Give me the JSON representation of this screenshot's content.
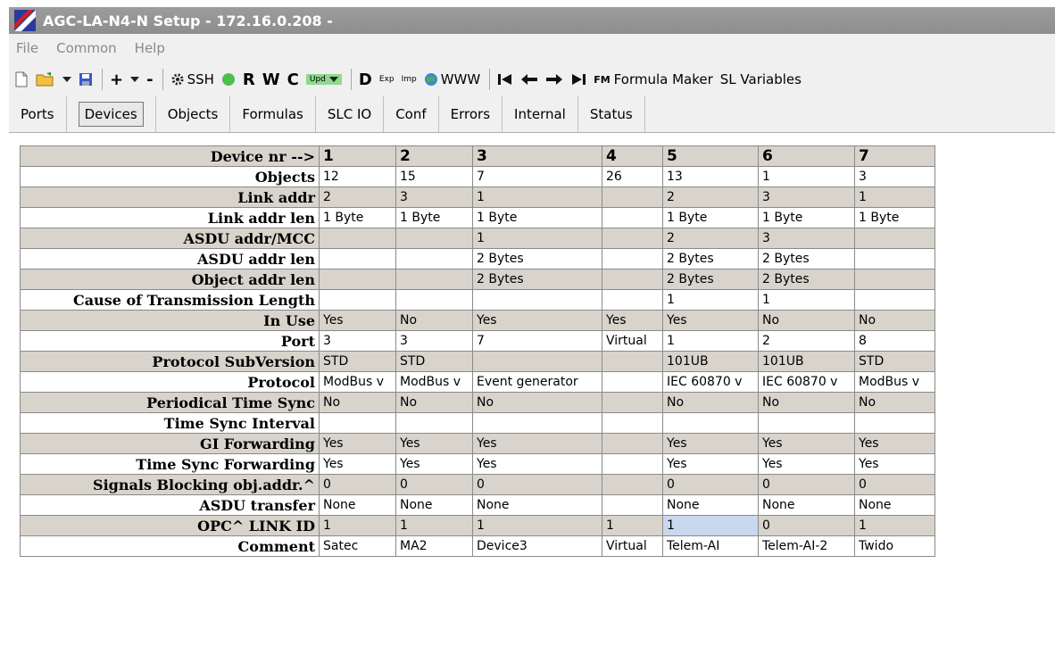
{
  "window": {
    "title": "AGC-LA-N4-N Setup - 172.16.0.208 -"
  },
  "menu": [
    "File",
    "Common",
    "Help"
  ],
  "toolbar": {
    "ssh": "SSH",
    "r": "R",
    "w": "W",
    "c": "C",
    "upd": "Upd",
    "d": "D",
    "exp": "Exp",
    "imp": "Imp",
    "www": "WWW",
    "fm": "FM",
    "formula_maker": "Formula Maker",
    "sl_variables": "SL Variables"
  },
  "tabs": [
    "Ports",
    "Devices",
    "Objects",
    "Formulas",
    "SLC IO",
    "Conf",
    "Errors",
    "Internal",
    "Status"
  ],
  "active_tab": "Devices",
  "table": {
    "columns": [
      "1",
      "2",
      "3",
      "4",
      "5",
      "6",
      "7"
    ],
    "header_label": "Device nr -->",
    "rows": [
      {
        "label": "Objects",
        "cells": [
          "12",
          "15",
          "7",
          "26",
          "13",
          "1",
          "3"
        ]
      },
      {
        "label": "Link addr",
        "cells": [
          "2",
          "3",
          "1",
          "",
          "2",
          "3",
          "1"
        ]
      },
      {
        "label": "Link addr len",
        "cells": [
          "1 Byte",
          "1 Byte",
          "1 Byte",
          "",
          "1 Byte",
          "1 Byte",
          "1 Byte"
        ]
      },
      {
        "label": "ASDU addr/MCC",
        "cells": [
          "",
          "",
          "1",
          "",
          "2",
          "3",
          ""
        ]
      },
      {
        "label": "ASDU addr len",
        "cells": [
          "",
          "",
          "2 Bytes",
          "",
          "2 Bytes",
          "2 Bytes",
          ""
        ]
      },
      {
        "label": "Object addr len",
        "cells": [
          "",
          "",
          "2 Bytes",
          "",
          "2 Bytes",
          "2 Bytes",
          ""
        ]
      },
      {
        "label": "Cause of Transmission Length",
        "cells": [
          "",
          "",
          "",
          "",
          "1",
          "1",
          ""
        ]
      },
      {
        "label": "In Use",
        "cells": [
          "Yes",
          "No",
          "Yes",
          "Yes",
          "Yes",
          "No",
          "No"
        ]
      },
      {
        "label": "Port",
        "cells": [
          "3",
          "3",
          "7",
          "Virtual",
          "1",
          "2",
          "8"
        ]
      },
      {
        "label": "Protocol SubVersion",
        "cells": [
          "STD",
          "STD",
          "",
          "",
          "101UB",
          "101UB",
          "STD"
        ]
      },
      {
        "label": "Protocol",
        "cells": [
          "ModBus v",
          "ModBus v",
          "Event generator",
          "",
          "IEC 60870 v",
          "IEC 60870 v",
          "ModBus v"
        ]
      },
      {
        "label": "Periodical Time Sync",
        "cells": [
          "No",
          "No",
          "No",
          "",
          "No",
          "No",
          "No"
        ]
      },
      {
        "label": "Time Sync Interval",
        "cells": [
          "",
          "",
          "",
          "",
          "",
          "",
          ""
        ]
      },
      {
        "label": "GI Forwarding",
        "cells": [
          "Yes",
          "Yes",
          "Yes",
          "",
          "Yes",
          "Yes",
          "Yes"
        ]
      },
      {
        "label": "Time Sync Forwarding",
        "cells": [
          "Yes",
          "Yes",
          "Yes",
          "",
          "Yes",
          "Yes",
          "Yes"
        ]
      },
      {
        "label": "Signals Blocking obj.addr.^",
        "cells": [
          "0",
          "0",
          "0",
          "",
          "0",
          "0",
          "0"
        ]
      },
      {
        "label": "ASDU transfer",
        "cells": [
          "None",
          "None",
          "None",
          "",
          "None",
          "None",
          "None"
        ]
      },
      {
        "label": "OPC^ LINK ID",
        "cells": [
          "1",
          "1",
          "1",
          "1",
          "1",
          "0",
          "1"
        ]
      },
      {
        "label": "Comment",
        "cells": [
          "Satec",
          "MA2",
          "Device3",
          "Virtual",
          "Telem-AI",
          "Telem-AI-2",
          "Twido"
        ]
      }
    ]
  },
  "colors": {
    "title_bar": "#9a9a9a",
    "row_gray": "#d8d4cc",
    "row_white": "#ffffff",
    "selected_cell": "#c8d8ee"
  },
  "selected_cell": {
    "row": "OPC^ LINK ID",
    "column": "5"
  }
}
